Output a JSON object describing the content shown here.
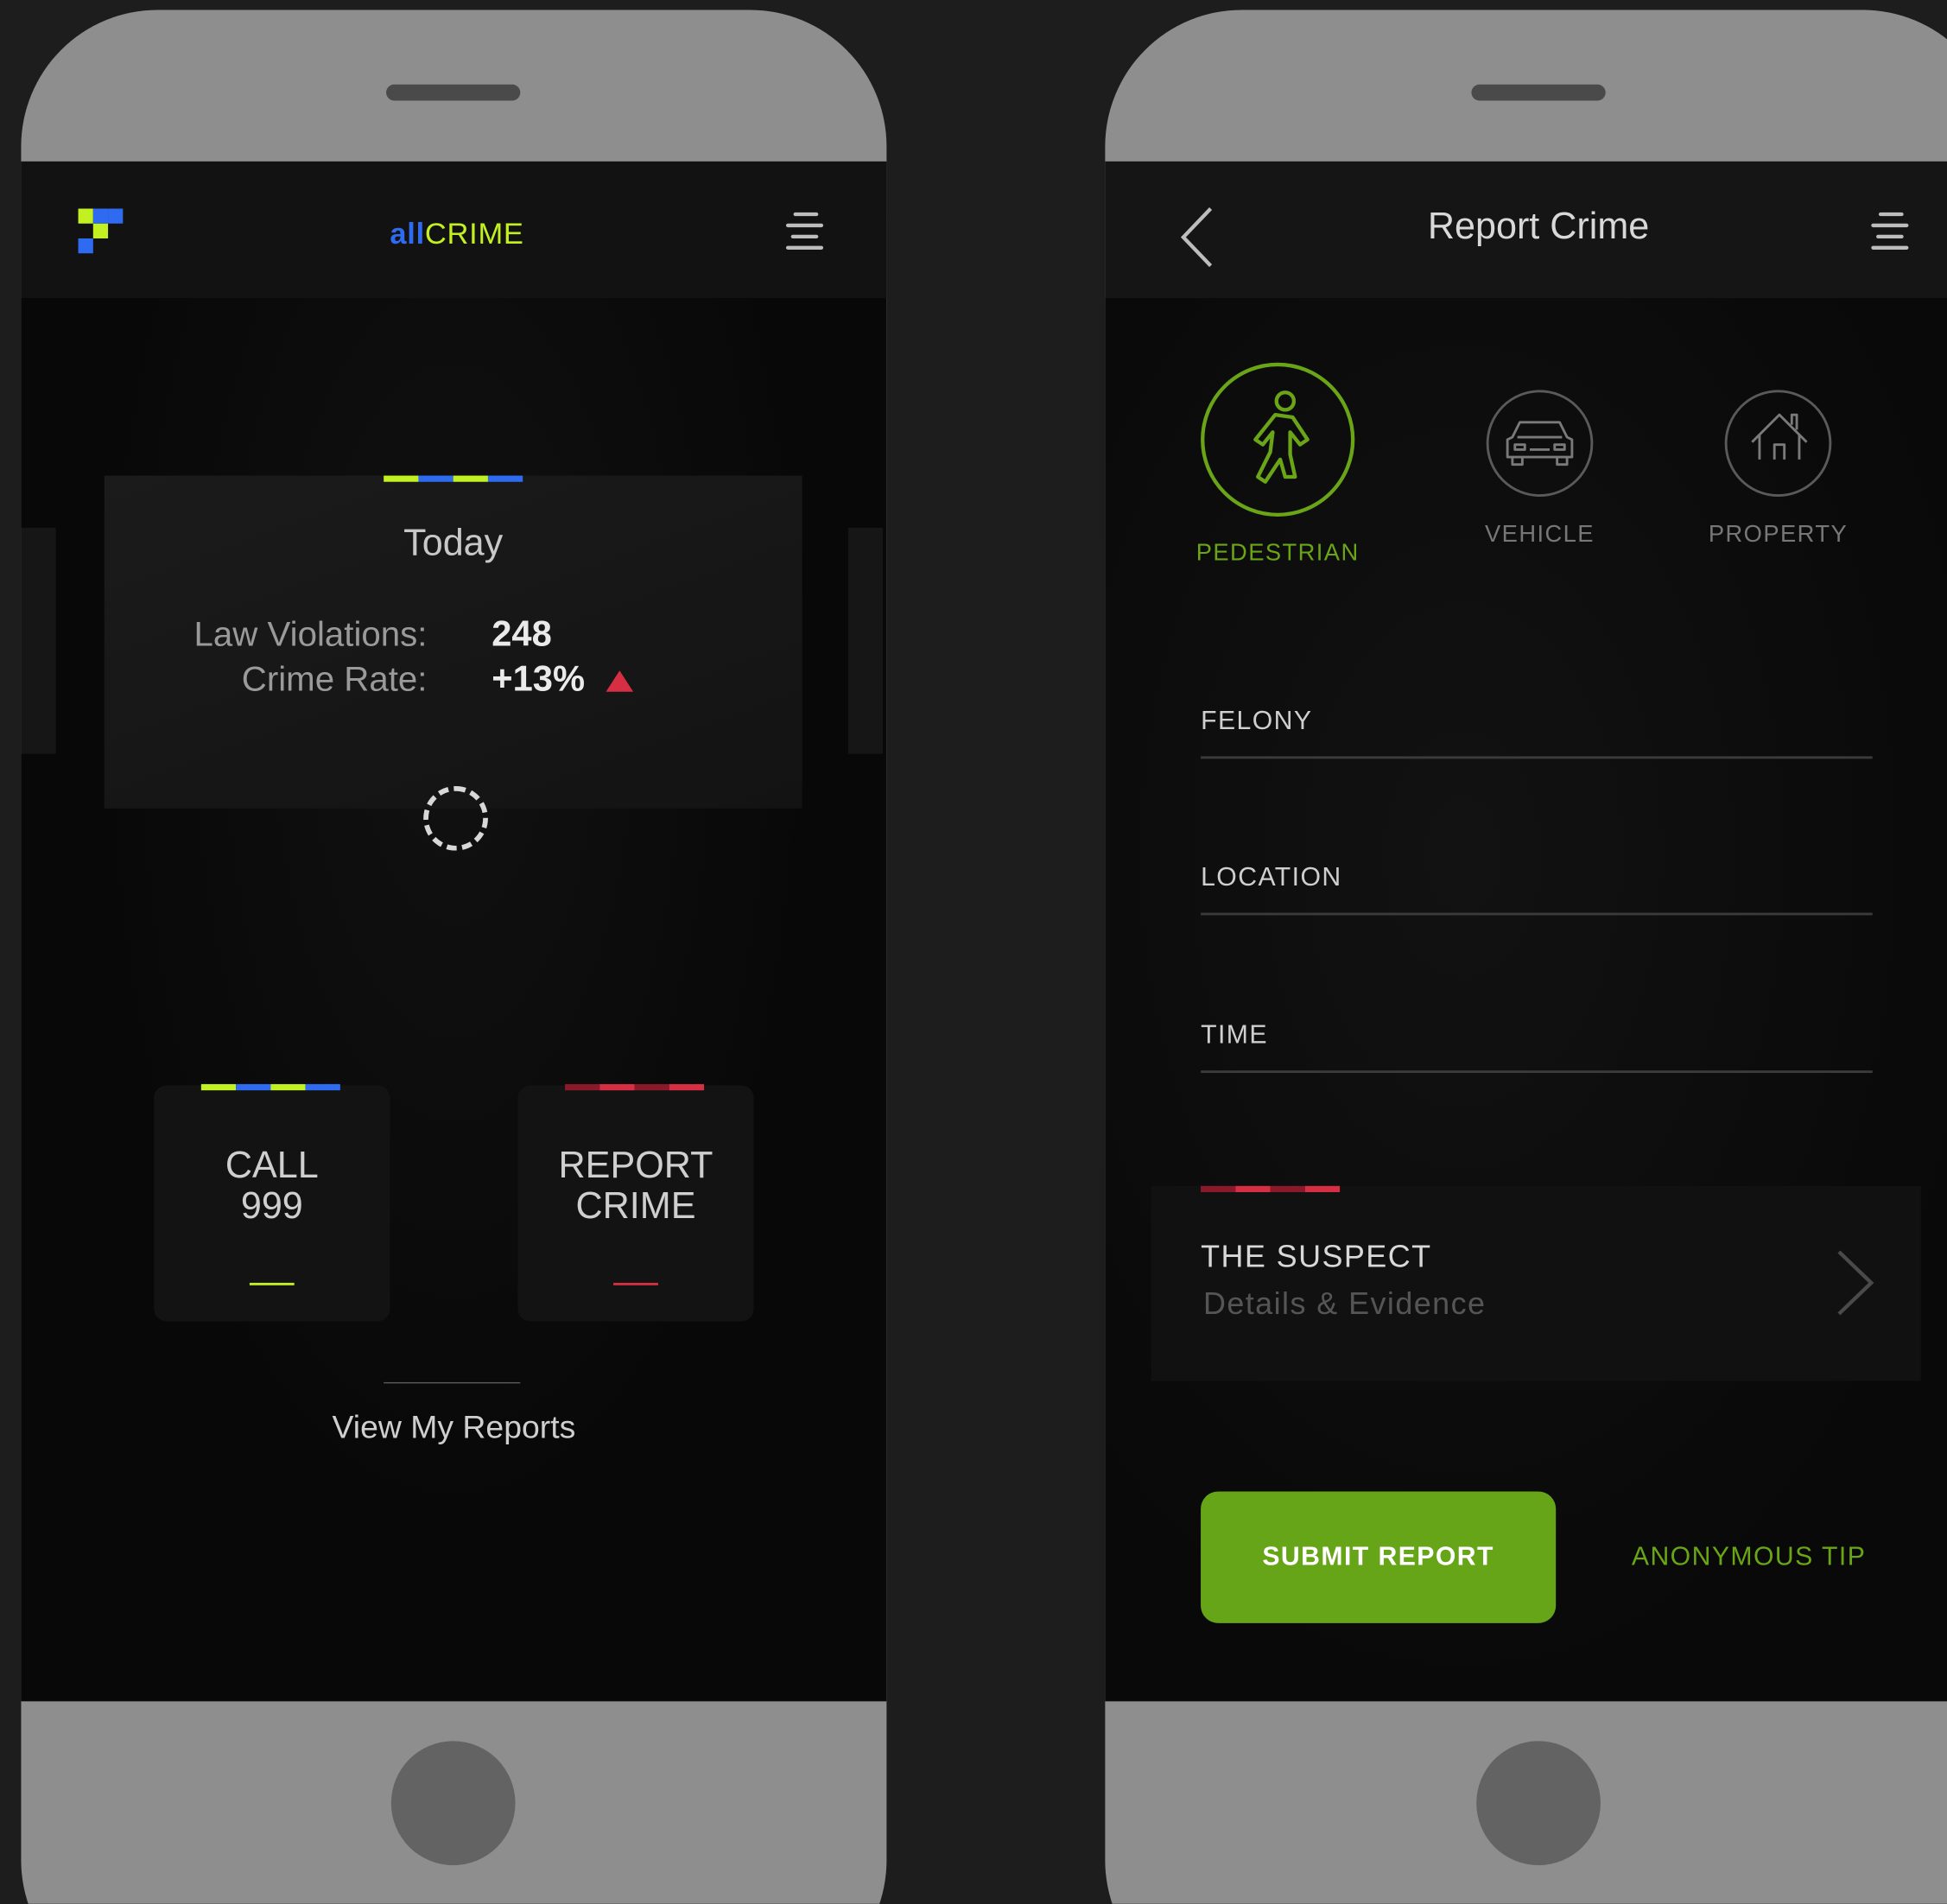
{
  "colors": {
    "brand_blue": "#2f6bf0",
    "brand_lime": "#c3f021",
    "alert_red": "#d62f43",
    "dark_red": "#8a1a2a",
    "accent_green": "#6aa517",
    "button_green": "#66a518",
    "muted_gray": "#777777"
  },
  "home_screen": {
    "brand": {
      "prefix": "all",
      "suffix": "CRIME"
    },
    "today_card": {
      "title": "Today",
      "law_violations_label": "Law Violations:",
      "law_violations_value": "248",
      "crime_rate_label": "Crime Rate:",
      "crime_rate_value": "+13%",
      "trend_icon": "triangle-up-icon"
    },
    "actions": [
      {
        "label": "CALL\n999"
      },
      {
        "label": "REPORT\nCRIME"
      }
    ],
    "view_reports_link": "View My Reports"
  },
  "report_screen": {
    "title": "Report Crime",
    "categories": [
      {
        "label": "PEDESTRIAN",
        "icon": "pedestrian-icon",
        "selected": true
      },
      {
        "label": "VEHICLE",
        "icon": "car-icon",
        "selected": false
      },
      {
        "label": "PROPERTY",
        "icon": "house-icon",
        "selected": false
      }
    ],
    "fields": [
      {
        "label": "FELONY"
      },
      {
        "label": "LOCATION"
      },
      {
        "label": "TIME"
      }
    ],
    "suspect": {
      "title": "THE SUSPECT",
      "subtitle": "Details & Evidence"
    },
    "submit_label": "SUBMIT REPORT",
    "anonymous_tip_label": "ANONYMOUS TIP"
  }
}
